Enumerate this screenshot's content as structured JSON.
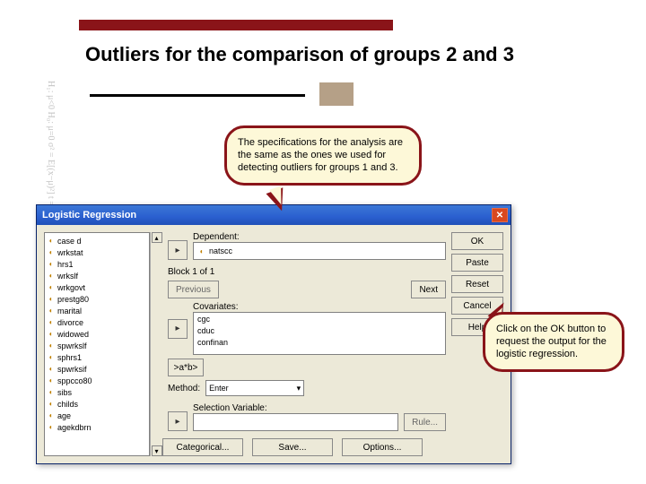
{
  "slide": {
    "title": "Outliers for the comparison of groups 2 and 3"
  },
  "callouts": {
    "c1": "The specifications for the analysis are the same as the ones we used for detecting outliers for groups 1 and 3.",
    "c2": "Click on the OK button to request the output for the logistic regression."
  },
  "dialog": {
    "title": "Logistic Regression",
    "close": "✕",
    "variables": [
      "case d",
      "wrkstat",
      "hrs1",
      "wrkslf",
      "wrkgovt",
      "prestg80",
      "marital",
      "divorce",
      "widowed",
      "spwrkslf",
      "sphrs1",
      "spwrksif",
      "sppcco80",
      "sibs",
      "childs",
      "age",
      "agekdbrn"
    ],
    "dependent_label": "Dependent:",
    "dependent_value": "natscc",
    "block_label": "Block 1 of 1",
    "prev": "Previous",
    "next": "Next",
    "covariates_label": "Covariates:",
    "covariates": [
      "cgc",
      "cduc",
      "confinan"
    ],
    "interaction": ">a*b>",
    "method_label": "Method:",
    "method_value": "Enter",
    "selvar_label": "Selection Variable:",
    "rule": "Rule...",
    "buttons": {
      "ok": "OK",
      "paste": "Paste",
      "reset": "Reset",
      "cancel": "Cancel",
      "help": "Help",
      "categorical": "Categorical...",
      "save": "Save...",
      "options": "Options..."
    }
  },
  "bg": "H₁: μ<0  H₀: μ=0  σ² = E[(x−μ)²]  t = x̄/s  W = Σ  x̄ = (1/n)Σxᵢ  β̂ = (XᵀX)⁻¹Xᵀy  f(x)+af₁"
}
